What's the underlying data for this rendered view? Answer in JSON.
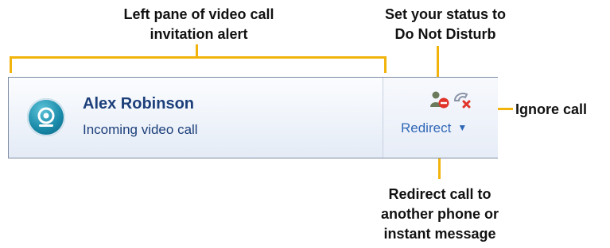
{
  "annotations": {
    "left_pane": [
      "Left pane of video call",
      "invitation alert"
    ],
    "dnd": [
      "Set your status to",
      "Do Not Disturb"
    ],
    "ignore": "Ignore call",
    "redirect": [
      "Redirect call to",
      "another phone or",
      "instant message"
    ]
  },
  "alert": {
    "caller_name": "Alex Robinson",
    "subtitle": "Incoming video call",
    "redirect_label": "Redirect",
    "icons": {
      "avatar": "video-camera-icon",
      "dnd": "do-not-disturb-icon",
      "ignore": "ignore-call-icon",
      "dropdown": "chevron-down-icon"
    }
  },
  "colors": {
    "callout_line": "#f2b40c",
    "accent_text": "#1c3f7a",
    "link": "#2f67b7"
  }
}
